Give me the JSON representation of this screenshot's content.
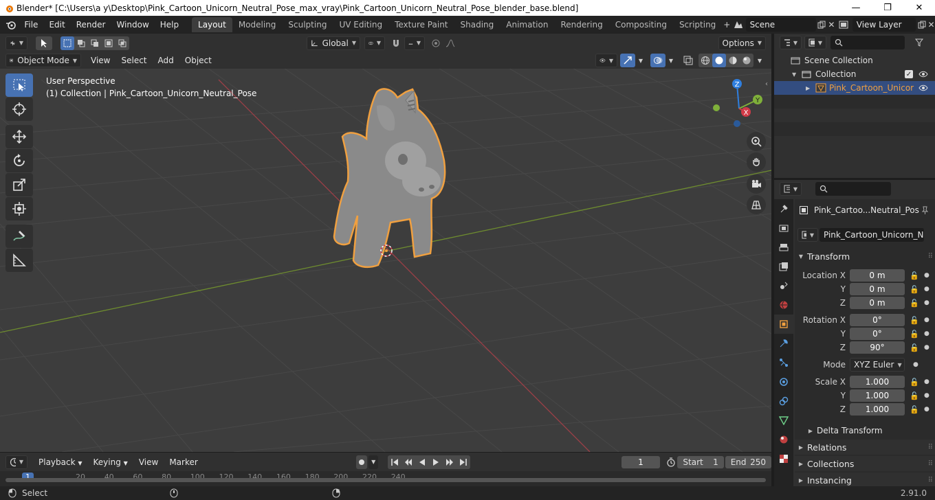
{
  "window": {
    "title": "Blender* [C:\\Users\\a y\\Desktop\\Pink_Cartoon_Unicorn_Neutral_Pose_max_vray\\Pink_Cartoon_Unicorn_Neutral_Pose_blender_base.blend]",
    "minimize": "—",
    "maximize": "❐",
    "close": "✕"
  },
  "menu": [
    "File",
    "Edit",
    "Render",
    "Window",
    "Help"
  ],
  "workspaces": [
    "Layout",
    "Modeling",
    "Sculpting",
    "UV Editing",
    "Texture Paint",
    "Shading",
    "Animation",
    "Rendering",
    "Compositing",
    "Scripting"
  ],
  "active_workspace": "Layout",
  "scene": {
    "name": "Scene",
    "view_layer": "View Layer"
  },
  "tool_header": {
    "orientation": "Global",
    "options": "Options"
  },
  "viewport_header": {
    "mode": "Object Mode",
    "menus": [
      "View",
      "Select",
      "Add",
      "Object"
    ]
  },
  "viewport": {
    "perspective": "User Perspective",
    "collection_info": "(1) Collection | Pink_Cartoon_Unicorn_Neutral_Pose"
  },
  "gizmo": {
    "x": "X",
    "y": "Y",
    "z": "Z"
  },
  "outliner": {
    "scene_collection": "Scene Collection",
    "collection": "Collection",
    "object": "Pink_Cartoon_Unicor"
  },
  "properties": {
    "object_name_short": "Pink_Cartoo...Neutral_Pos",
    "object_name_field": "Pink_Cartoon_Unicorn_Neut...",
    "transform_label": "Transform",
    "location": {
      "label": "Location X",
      "x": "0 m",
      "y": "0 m",
      "z": "0 m"
    },
    "rotation": {
      "label": "Rotation X",
      "x": "0°",
      "y": "0°",
      "z": "90°"
    },
    "mode_label": "Mode",
    "mode_value": "XYZ Euler",
    "scale": {
      "label": "Scale X",
      "x": "1.000",
      "y": "1.000",
      "z": "1.000"
    },
    "axis_y": "Y",
    "axis_z": "Z",
    "delta": "Delta Transform",
    "sections": [
      "Relations",
      "Collections",
      "Instancing"
    ]
  },
  "timeline": {
    "menus": [
      "Playback",
      "Keying",
      "View",
      "Marker"
    ],
    "current_frame": "1",
    "start_label": "Start",
    "start": "1",
    "end_label": "End",
    "end": "250",
    "ticks": [
      "1",
      "20",
      "40",
      "60",
      "80",
      "100",
      "120",
      "140",
      "160",
      "180",
      "200",
      "220",
      "240"
    ]
  },
  "status": {
    "left": "Select",
    "version": "2.91.0"
  },
  "colors": {
    "accent": "#4772b3",
    "selection_outline": "#f0a040",
    "x_axis": "#d13a47",
    "y_axis": "#7fb03a",
    "z_axis": "#2f7fe0"
  }
}
